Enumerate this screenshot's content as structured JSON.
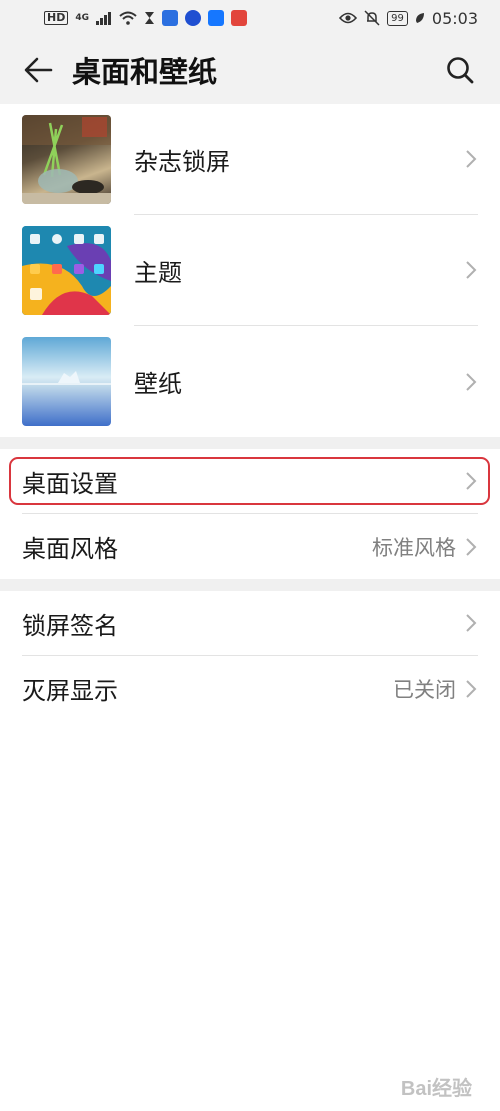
{
  "status_bar": {
    "hd": "HD",
    "network": "4G",
    "battery": "99",
    "time": "05:03",
    "colors": {
      "app1": "#2b6fe0",
      "app2": "#1f4fd1",
      "app3": "#1677ff",
      "app4": "#e2453c"
    }
  },
  "header": {
    "title": "桌面和壁纸",
    "back_icon": "arrow-left-icon",
    "search_icon": "search-icon"
  },
  "thumb_items": [
    {
      "label": "杂志锁屏",
      "image": "magazine-lock-thumb"
    },
    {
      "label": "主题",
      "image": "theme-thumb"
    },
    {
      "label": "壁纸",
      "image": "wallpaper-thumb"
    }
  ],
  "settings_group_1": [
    {
      "label": "桌面设置",
      "value": "",
      "highlighted": true
    },
    {
      "label": "桌面风格",
      "value": "标准风格"
    }
  ],
  "settings_group_2": [
    {
      "label": "锁屏签名",
      "value": ""
    },
    {
      "label": "灭屏显示",
      "value": "已关闭"
    }
  ],
  "watermark": "Bai经验",
  "colors": {
    "highlight": "#d9363e",
    "chevron": "#b0b0b0",
    "value_text": "#808080"
  }
}
